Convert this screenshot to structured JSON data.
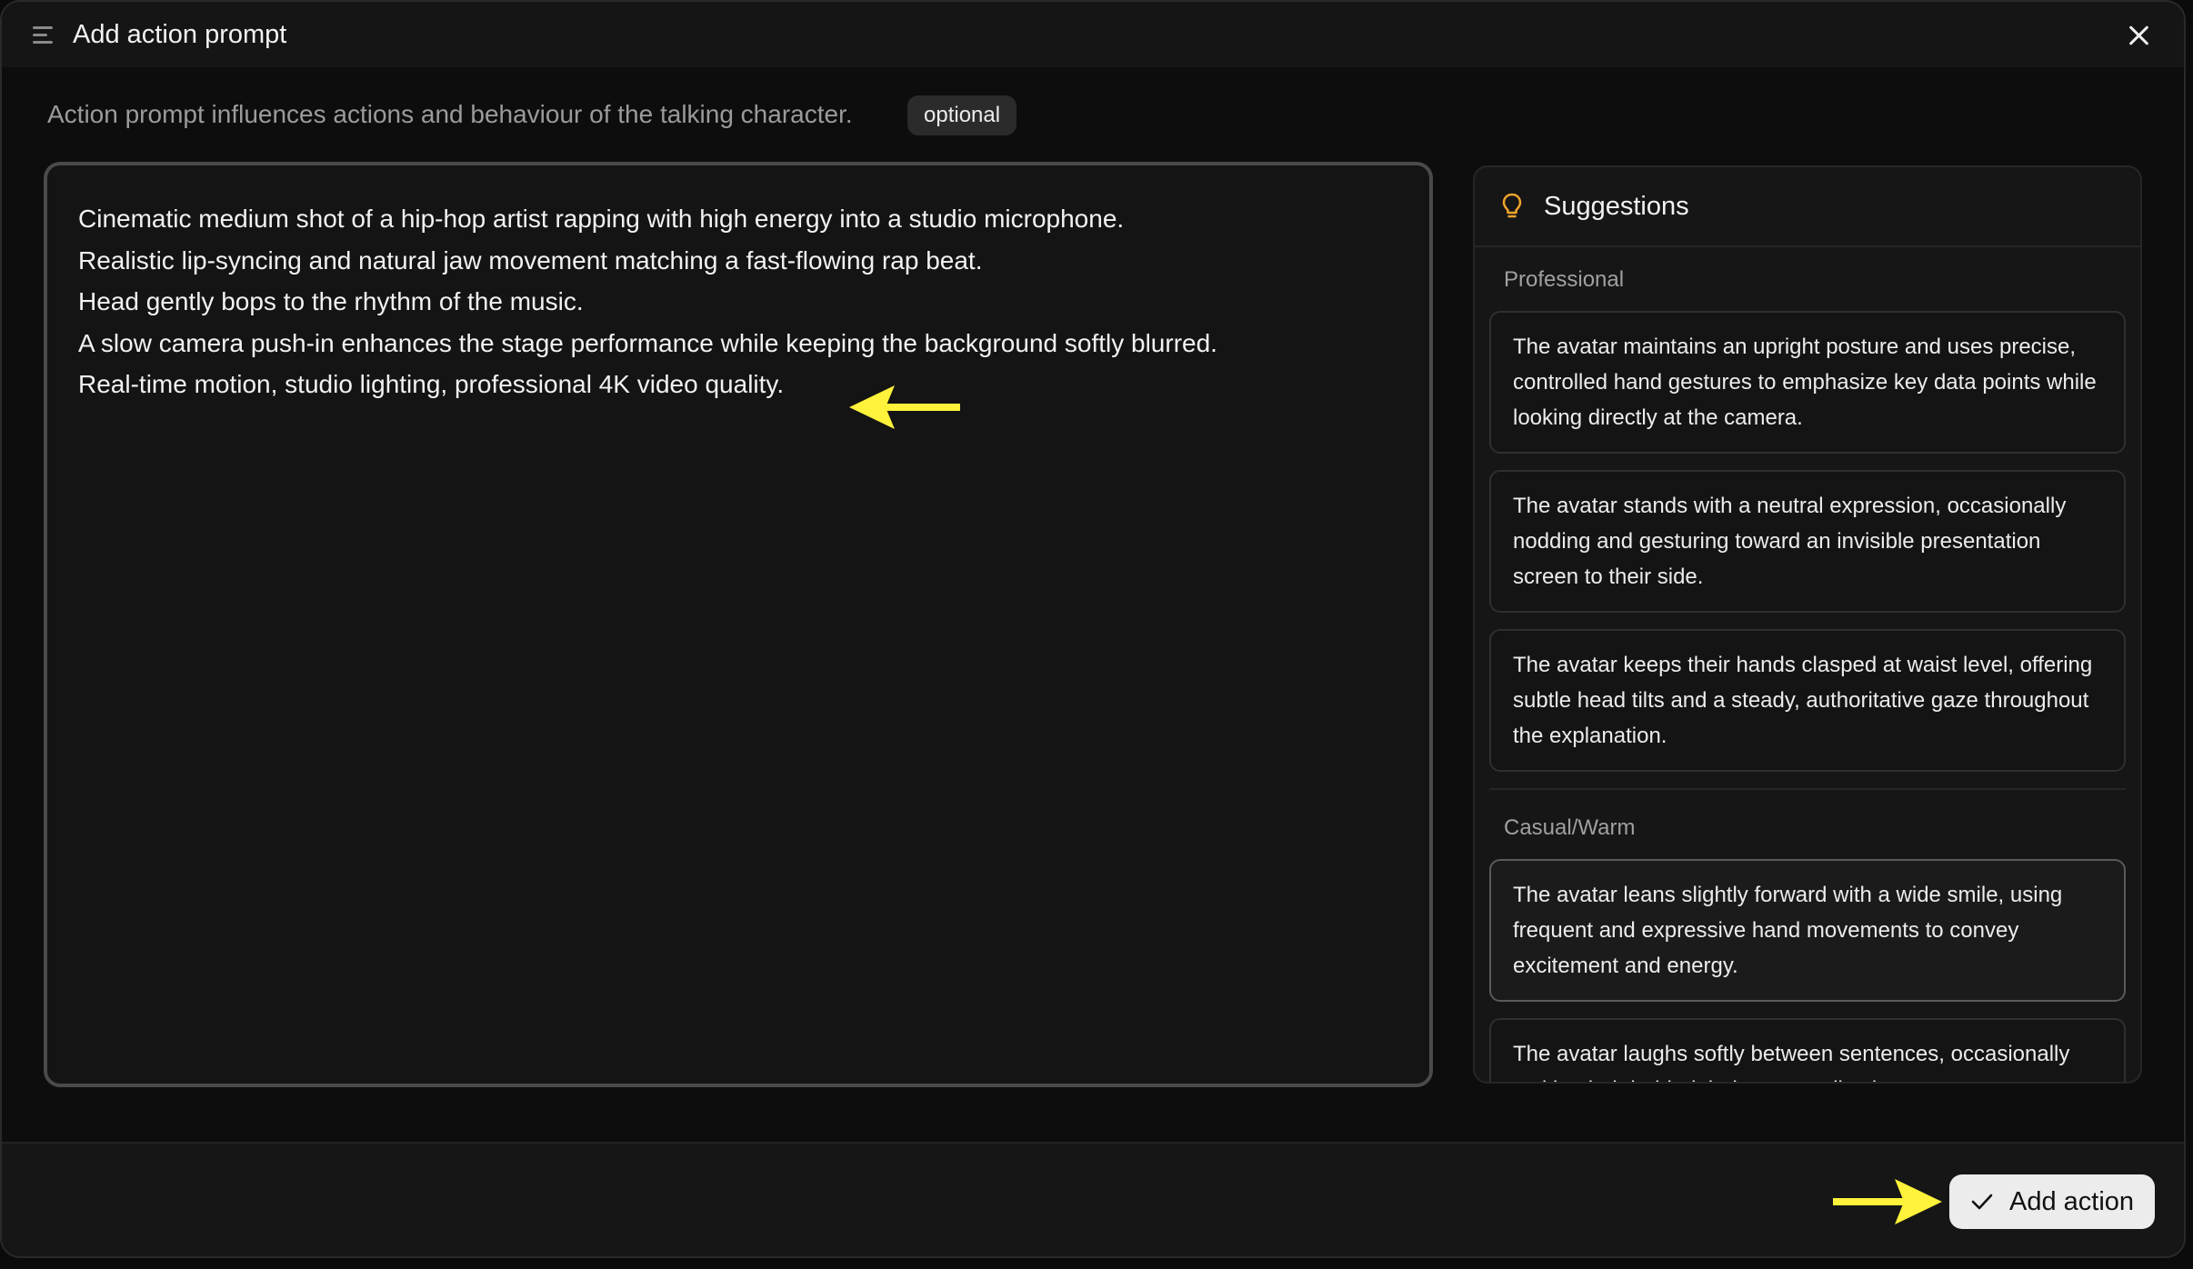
{
  "header": {
    "title": "Add action prompt",
    "menu_icon": "menu-icon",
    "close_icon": "close-icon"
  },
  "description": {
    "text": "Action prompt influences actions and behaviour of the talking character.",
    "badge": "optional"
  },
  "editor": {
    "lines": [
      "Cinematic medium shot of a hip-hop artist rapping with high energy into a studio microphone.",
      "Realistic lip-syncing and natural jaw movement matching a fast-flowing rap beat.",
      "Head gently bops to the rhythm of the music.",
      "A slow camera push-in enhances the stage performance while keeping the background softly blurred.",
      "Real-time motion, studio lighting, professional 4K video quality."
    ]
  },
  "suggestions": {
    "title": "Suggestions",
    "icon": "lightbulb-icon",
    "categories": [
      {
        "label": "Professional",
        "items": [
          "The avatar maintains an upright posture and uses precise, controlled hand gestures to emphasize key data points while looking directly at the camera.",
          "The avatar stands with a neutral expression, occasionally nodding and gesturing toward an invisible presentation screen to their side.",
          "The avatar keeps their hands clasped at waist level, offering subtle head tilts and a steady, authoritative gaze throughout the explanation."
        ]
      },
      {
        "label": "Casual/Warm",
        "items": [
          "The avatar leans slightly forward with a wide smile, using frequent and expressive hand movements to convey excitement and energy.",
          "The avatar laughs softly between sentences, occasionally tucking hair behind their ear or adjusting"
        ]
      }
    ]
  },
  "footer": {
    "add_label": "Add action",
    "check_icon": "check-icon"
  },
  "colors": {
    "annotation_arrow": "#fff23a",
    "button_bg": "#ececec",
    "bulb": "#f0a52a"
  }
}
